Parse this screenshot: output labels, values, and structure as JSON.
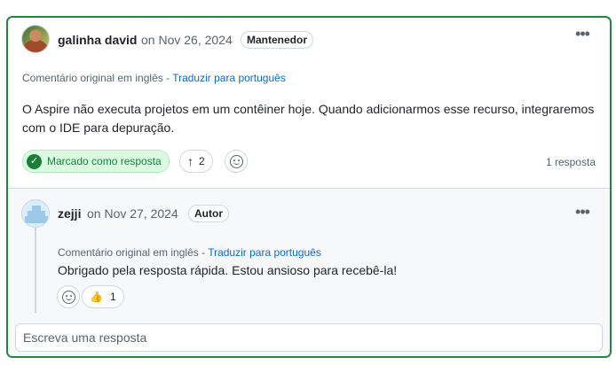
{
  "main_comment": {
    "author": "galinha david",
    "date": "on Nov 26, 2024",
    "badge": "Mantenedor",
    "more_icon": "kebab-horizontal-icon",
    "translate_prefix": "Comentário original em inglês - ",
    "translate_link": "Traduzir para português",
    "body": "O Aspire não executa projetos em um contêiner hoje. Quando adicionarmos esse recurso, integraremos com o IDE para depuração.",
    "answer_label": "Marcado como resposta",
    "upvote_count": "2",
    "reply_count": "1 resposta"
  },
  "reply": {
    "author": "zejji",
    "date": "on Nov 27, 2024",
    "badge": "Autor",
    "more_icon": "kebab-horizontal-icon",
    "translate_prefix": "Comentário original em inglês - ",
    "translate_link": "Traduzir para português",
    "body": "Obrigado pela resposta rápida. Estou ansioso para recebê-la!",
    "thumbs_count": "1"
  },
  "reply_input": {
    "placeholder": "Escreva uma resposta"
  },
  "colors": {
    "accent_border": "#1f883d",
    "link": "#0969da",
    "answer_bg": "#dafbe1",
    "answer_text": "#1a7f37"
  }
}
